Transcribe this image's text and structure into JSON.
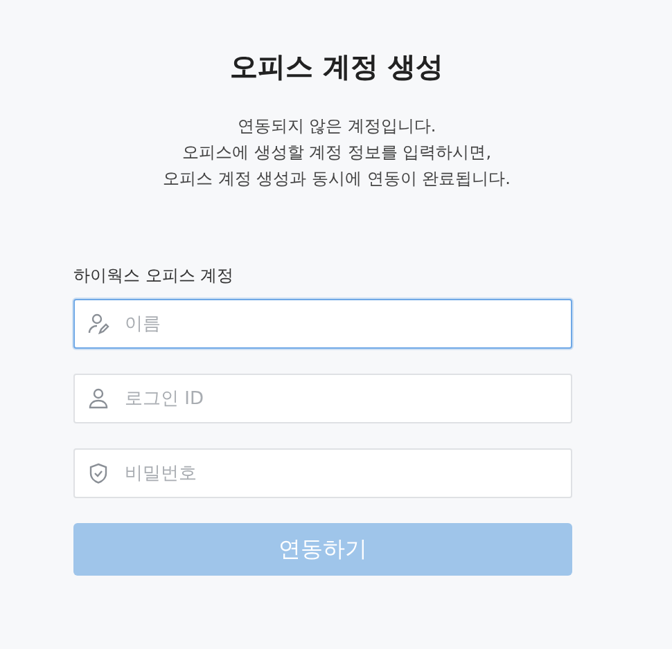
{
  "title": "오피스 계정 생성",
  "description": [
    "연동되지 않은 계정입니다.",
    "오피스에 생성할 계정 정보를 입력하시면,",
    "오피스 계정 생성과 동시에 연동이 완료됩니다."
  ],
  "form_label": "하이웍스 오피스 계정",
  "fields": [
    {
      "kind": "name",
      "placeholder": "이름",
      "focused": true
    },
    {
      "kind": "user",
      "placeholder": "로그인 ID",
      "focused": false
    },
    {
      "kind": "password",
      "placeholder": "비밀번호",
      "focused": false
    }
  ],
  "button": {
    "label": "연동하기",
    "disabled": true
  }
}
